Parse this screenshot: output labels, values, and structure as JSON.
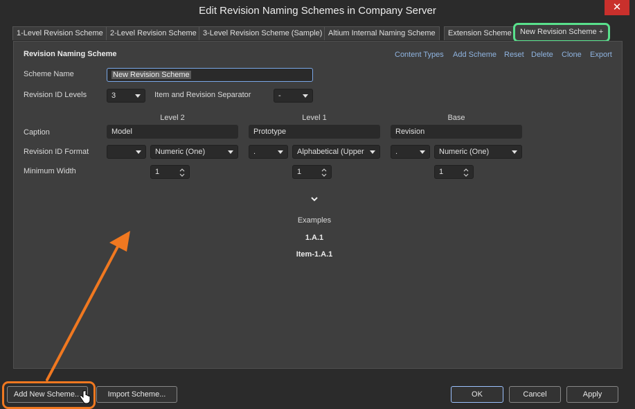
{
  "window": {
    "title": "Edit Revision Naming Schemes in Company Server",
    "close_glyph": "✕"
  },
  "tabs": [
    {
      "label": "1-Level Revision Scheme"
    },
    {
      "label": "2-Level Revision Scheme"
    },
    {
      "label": "3-Level Revision Scheme (Sample)"
    },
    {
      "label": "Altium Internal Naming Scheme"
    },
    {
      "label": "Extension Scheme"
    },
    {
      "label": "New Revision Scheme +"
    }
  ],
  "panel": {
    "heading": "Revision Naming Scheme",
    "actions": [
      "Content Types",
      "Add Scheme",
      "Reset",
      "Delete",
      "Clone",
      "Export"
    ],
    "scheme_name_label": "Scheme Name",
    "scheme_name_value": "New Revision Scheme",
    "levels_label": "Revision ID Levels",
    "levels_value": "3",
    "separator_label": "Item and Revision Separator",
    "separator_value": "-",
    "columns": [
      {
        "header": "Level 2",
        "caption": "Model",
        "sep": "",
        "format": "Numeric (One)",
        "min_width": "1"
      },
      {
        "header": "Level 1",
        "caption": "Prototype",
        "sep": ".",
        "format": "Alphabetical (Upper",
        "min_width": "1"
      },
      {
        "header": "Base",
        "caption": "Revision",
        "sep": ".",
        "format": "Numeric (One)",
        "min_width": "1"
      }
    ],
    "caption_label": "Caption",
    "format_label": "Revision ID Format",
    "min_width_label": "Minimum Width",
    "examples_label": "Examples",
    "example_1": "1.A.1",
    "example_2": "Item-1.A.1"
  },
  "footer": {
    "add_new_scheme": "Add New Scheme...",
    "import_scheme": "Import Scheme...",
    "ok": "OK",
    "cancel": "Cancel",
    "apply": "Apply"
  },
  "colors": {
    "accent_link": "#8fb4e0",
    "highlight_green": "#59e08c",
    "annotation_orange": "#f07820",
    "close_red": "#c9302c"
  }
}
